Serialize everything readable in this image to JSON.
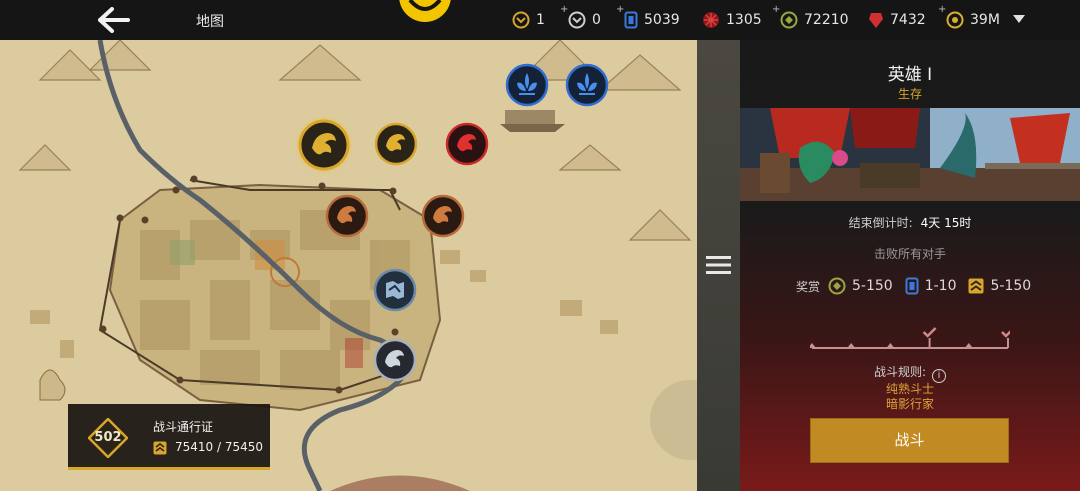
{
  "topbar": {
    "back_icon": "arrow-left-icon",
    "title": "地图",
    "resources": [
      {
        "icon": "gold-key-icon",
        "value": "1",
        "color": "#d6a432"
      },
      {
        "icon": "silver-key-icon",
        "value": "0",
        "color": "#cfcfcf"
      },
      {
        "icon": "blue-card-icon",
        "value": "5039",
        "color": "#3a78e0"
      },
      {
        "icon": "red-orb-icon",
        "value": "1305",
        "color": "#c42a2a"
      },
      {
        "icon": "green-coin-icon",
        "value": "72210",
        "color": "#9aa640"
      },
      {
        "icon": "red-gem-icon",
        "value": "7432",
        "color": "#d03030"
      },
      {
        "icon": "gold-coin-icon",
        "value": "39M",
        "color": "#d8b030"
      }
    ],
    "dropdown_icon": "chevron-down-icon"
  },
  "map": {
    "nodes": [
      {
        "name": "gold-dragon-boss-node",
        "state": "current"
      },
      {
        "name": "gold-dragon-node",
        "state": "available"
      },
      {
        "name": "red-dragon-node",
        "state": "locked"
      },
      {
        "name": "blue-fleur-node-1",
        "state": "locked"
      },
      {
        "name": "blue-fleur-node-2",
        "state": "locked"
      },
      {
        "name": "bronze-dragon-node-1",
        "state": "available"
      },
      {
        "name": "bronze-dragon-node-2",
        "state": "available"
      },
      {
        "name": "map-fragment-node",
        "state": "available"
      },
      {
        "name": "silver-dragon-node",
        "state": "available"
      }
    ]
  },
  "battle_pass": {
    "level": "502",
    "title": "战斗通行证",
    "xp": "75410 / 75450"
  },
  "panel": {
    "title": "英雄 I",
    "mode": "生存",
    "countdown_label": "结束倒计时:",
    "countdown_value": "4天 15时",
    "objective": "击败所有对手",
    "rewards_label": "奖赏",
    "rewards": [
      {
        "icon": "green-coin-icon",
        "value": "5-150"
      },
      {
        "icon": "blue-card-icon",
        "value": "1-10"
      },
      {
        "icon": "gold-chevron-icon",
        "value": "5-150"
      }
    ],
    "progress_checked": [
      false,
      false,
      false,
      true,
      false,
      true
    ],
    "rules_label": "战斗规则:",
    "rules": [
      "纯熟斗士",
      "暗影行家"
    ],
    "fight_label": "战斗",
    "accent_color": "#c28a22"
  }
}
